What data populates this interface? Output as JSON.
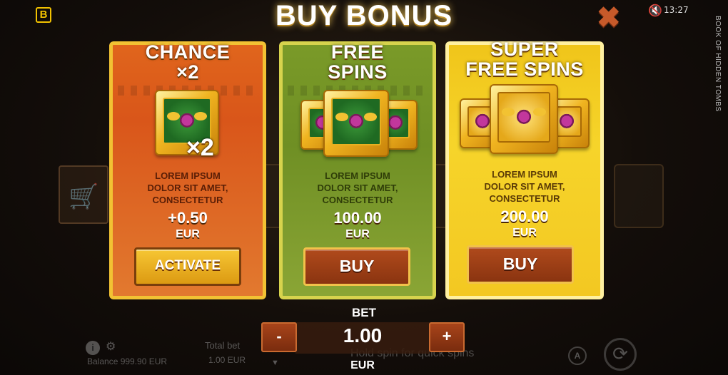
{
  "header": {
    "brand_badge": "B",
    "title": "BUY BONUS",
    "close_symbol": "✖",
    "mute_symbol": "🔇",
    "clock": "13:27",
    "game_name": "BOOK OF HIDDEN TOMBS"
  },
  "cards": {
    "chance": {
      "title_line1": "CHANCE",
      "title_line2": "×2",
      "multiplier_tag": "×2",
      "desc_line1": "LOREM IPSUM",
      "desc_line2": "DOLOR SIT AMET,",
      "desc_line3": "CONSECTETUR",
      "price": "+0.50",
      "currency": "EUR",
      "button_label": "ACTIVATE",
      "color": "#e0651c"
    },
    "free_spins": {
      "title_line1": "FREE",
      "title_line2": "SPINS",
      "desc_line1": "LOREM IPSUM",
      "desc_line2": "DOLOR SIT AMET,",
      "desc_line3": "CONSECTETUR",
      "price": "100.00",
      "currency": "EUR",
      "button_label": "BUY",
      "color": "#7a9a28"
    },
    "super_free_spins": {
      "title_line1": "SUPER",
      "title_line2": "FREE SPINS",
      "desc_line1": "LOREM IPSUM",
      "desc_line2": "DOLOR SIT AMET,",
      "desc_line3": "CONSECTETUR",
      "price": "200.00",
      "currency": "EUR",
      "button_label": "BUY",
      "color": "#f3c822"
    }
  },
  "bet": {
    "label": "BET",
    "value": "1.00",
    "currency": "EUR",
    "minus_label": "-",
    "plus_label": "+"
  },
  "footer": {
    "info_symbol": "i",
    "gear_symbol": "⚙",
    "balance": "Balance 999.90 EUR",
    "total_bet_label": "Total bet",
    "total_bet_value": "1.00 EUR",
    "hold_hint": "Hold spin for quick spins",
    "arrow": "▼",
    "auto_label": "A",
    "spin_symbol": "⟳"
  },
  "cart_symbol": "🛒"
}
